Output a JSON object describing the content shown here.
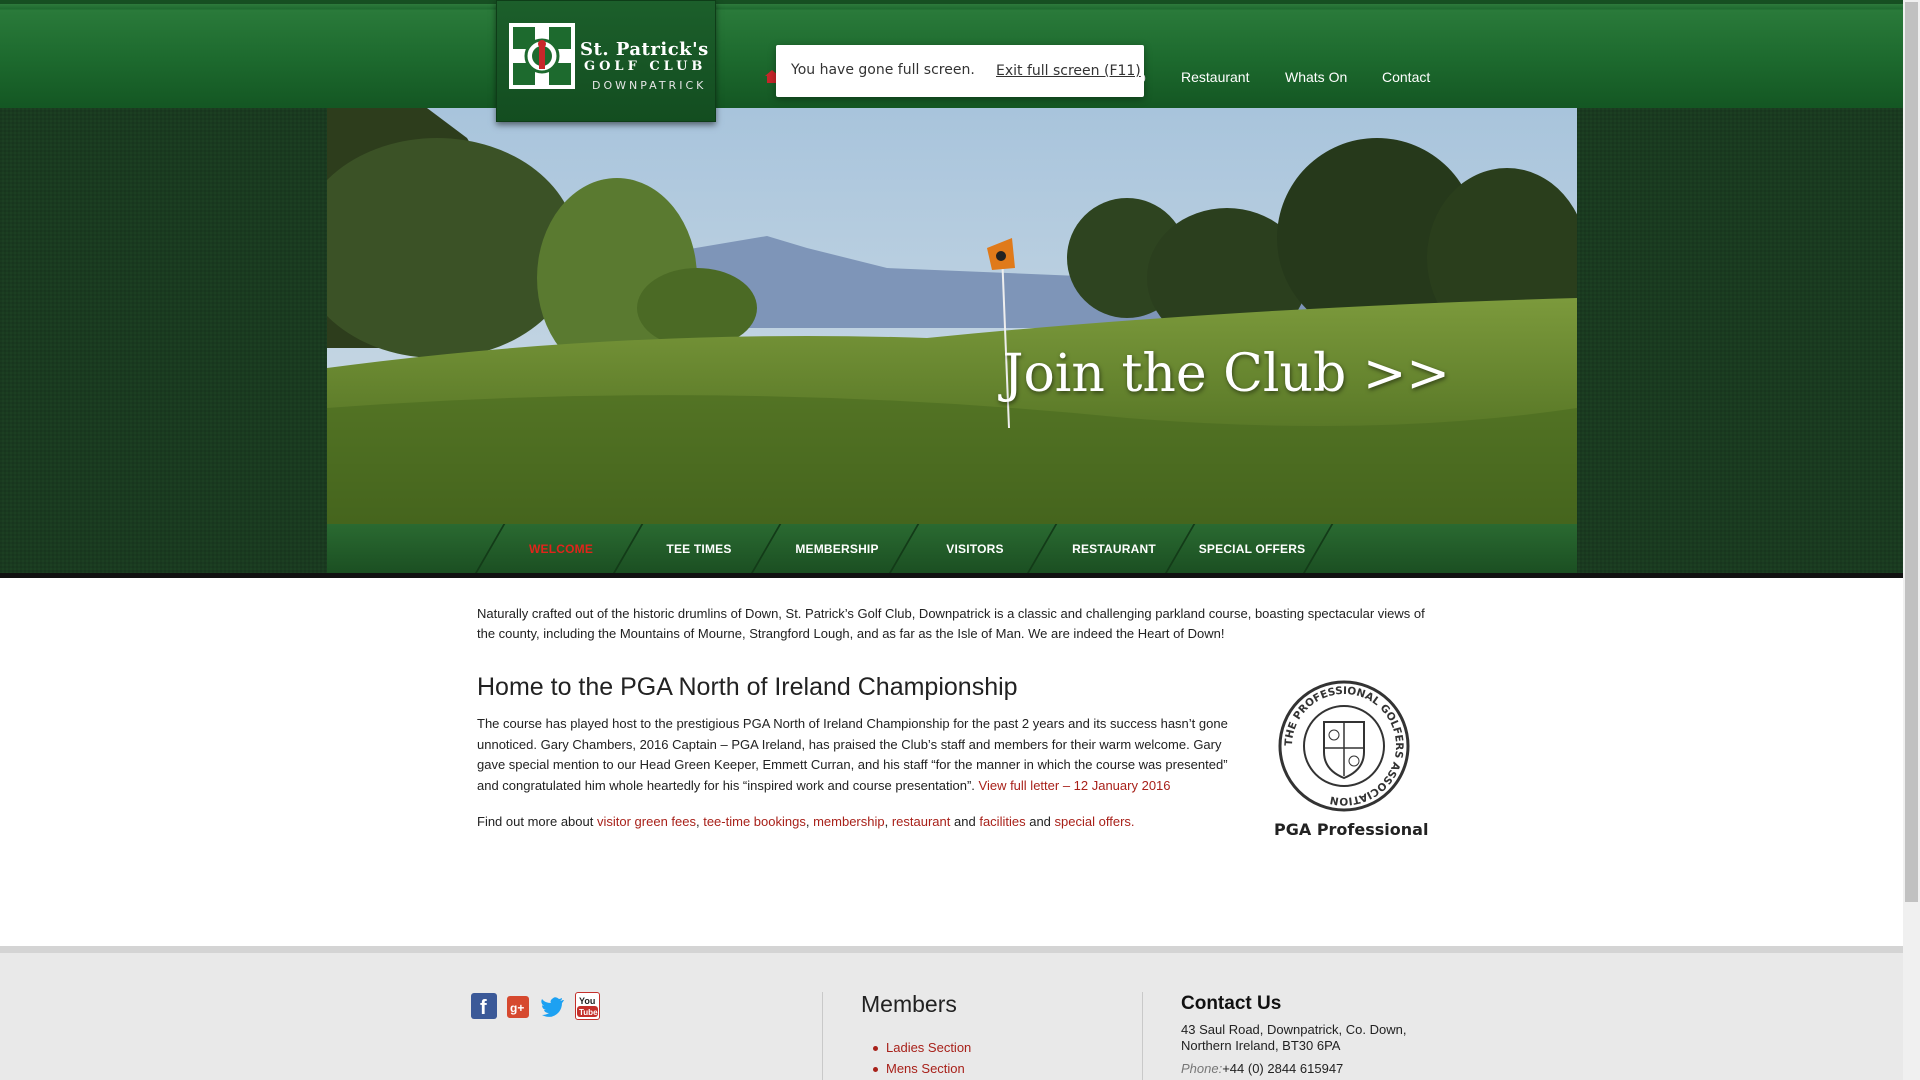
{
  "logo": {
    "line1": "St. Patrick's",
    "line2": "GOLF CLUB",
    "line3": "DOWNPATRICK"
  },
  "top_nav": {
    "partial_hidden": "p",
    "items": [
      "Restaurant",
      "Whats On",
      "Contact"
    ]
  },
  "fullscreen_notice": {
    "message": "You have gone full screen.",
    "exit_label": "Exit full screen (F11)"
  },
  "hero": {
    "cta": "Join the Club >>"
  },
  "sub_nav": {
    "items": [
      "WELCOME",
      "TEE TIMES",
      "MEMBERSHIP",
      "VISITORS",
      "RESTAURANT",
      "SPECIAL OFFERS"
    ],
    "active_color": "#e0241b"
  },
  "intro": {
    "text": "Naturally crafted out of the historic drumlins of Down, St. Patrick’s Golf Club, Downpatrick is a classic and challenging parkland course, boasting spectacular views of the county, including the Mountains of Mourne, Strangford Lough, and as far as the Isle of Man. We are indeed the Heart of Down!"
  },
  "championship": {
    "heading": "Home to the PGA North of Ireland Championship",
    "body": "The course has played host to the prestigious PGA North of Ireland Championship for the past 2 years and its success hasn’t gone unnoticed. Gary Chambers, 2016 Captain – PGA Ireland, has praised the Club’s staff and members for their warm welcome. Gary gave special mention to our Head Green Keeper, Emmett Curran, and his staff “for the manner in which the course was presented” and congratulated him whole heartedly for his “inspired work and course presentation”.",
    "letter_link": "View full letter – 12 January 2016",
    "find_out_prefix": "Find out more about",
    "links": [
      "visitor green fees",
      "tee-time bookings",
      "membership",
      "restaurant"
    ],
    "and1": "and",
    "link_facilities": "facilities",
    "and2": "and",
    "link_offers": "special offers",
    "end": "."
  },
  "pga": {
    "badge_text": "THE PROFESSIONAL GOLFERS ASSOCIATION",
    "label": "PGA Professional"
  },
  "footer": {
    "social": [
      "facebook-icon",
      "google-plus-icon",
      "twitter-icon",
      "youtube-icon"
    ],
    "members_title": "Members",
    "members_items": [
      "Ladies Section",
      "Mens Section"
    ],
    "contact_title": "Contact Us",
    "address_line1": "43 Saul Road, Downpatrick, Co. Down,",
    "address_line2": "Northern Ireland, BT30 6PA",
    "phone_label": "Phone:",
    "phone": "+44 (0) 2844 615947"
  },
  "colors": {
    "brand_green": "#1d6a2e",
    "link_red": "#a8211a",
    "footer_bg": "#e9e9e9"
  }
}
